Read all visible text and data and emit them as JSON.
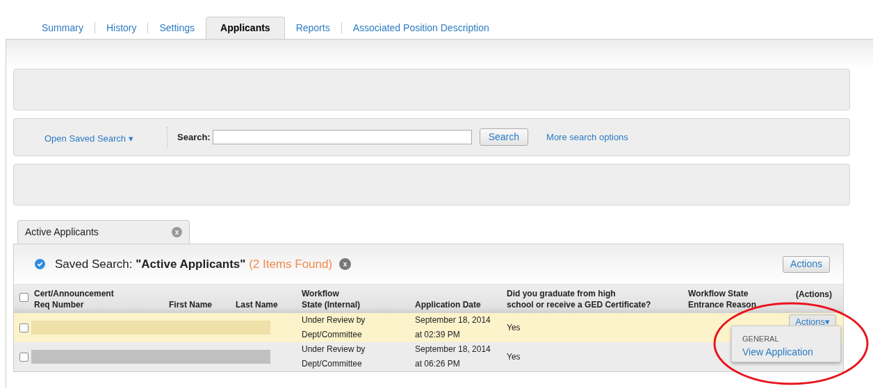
{
  "tabs": [
    {
      "label": "Summary",
      "selected": false
    },
    {
      "label": "History",
      "selected": false
    },
    {
      "label": "Settings",
      "selected": false
    },
    {
      "label": "Applicants",
      "selected": true
    },
    {
      "label": "Reports",
      "selected": false
    },
    {
      "label": "Associated Position Description",
      "selected": false
    }
  ],
  "search_bar": {
    "saved_search_link": "Open Saved Search ▾",
    "label": "Search:",
    "button": "Search",
    "more_link": "More search options"
  },
  "result_tab": {
    "label": "Active Applicants",
    "close": "x"
  },
  "saved_search": {
    "checked": true,
    "prefix": "Saved Search:",
    "name": "\"Active Applicants\"",
    "count": "(2 Items Found)",
    "clear": "x",
    "actions_button": "Actions"
  },
  "table": {
    "select_all_checked": false,
    "columns": [
      {
        "lines": [
          "Cert/Announcement",
          "Req Number"
        ]
      },
      {
        "lines": [
          "First Name"
        ]
      },
      {
        "lines": [
          "Last Name"
        ]
      },
      {
        "lines": [
          "Workflow",
          "State (Internal)"
        ]
      },
      {
        "lines": [
          "Application Date"
        ]
      },
      {
        "lines": [
          "Did you graduate from high",
          "school or receive a GED Certificate?"
        ]
      },
      {
        "lines": [
          "Workflow State",
          "Entrance Reason"
        ]
      },
      {
        "lines": [
          "(Actions)"
        ]
      }
    ],
    "rows": [
      {
        "selected": true,
        "checked": false,
        "state": [
          "Under Review by",
          "Dept/Committee"
        ],
        "date": [
          "September 18, 2014",
          "at 02:39 PM"
        ],
        "graduated": "Yes",
        "actions": "Actions▾"
      },
      {
        "selected": false,
        "checked": false,
        "state": [
          "Under Review by",
          "Dept/Committee"
        ],
        "date": [
          "September 18, 2014",
          "at 06:26 PM"
        ],
        "graduated": "Yes"
      }
    ]
  },
  "actions_menu": {
    "heading": "GENERAL",
    "items": [
      "View Application"
    ]
  }
}
